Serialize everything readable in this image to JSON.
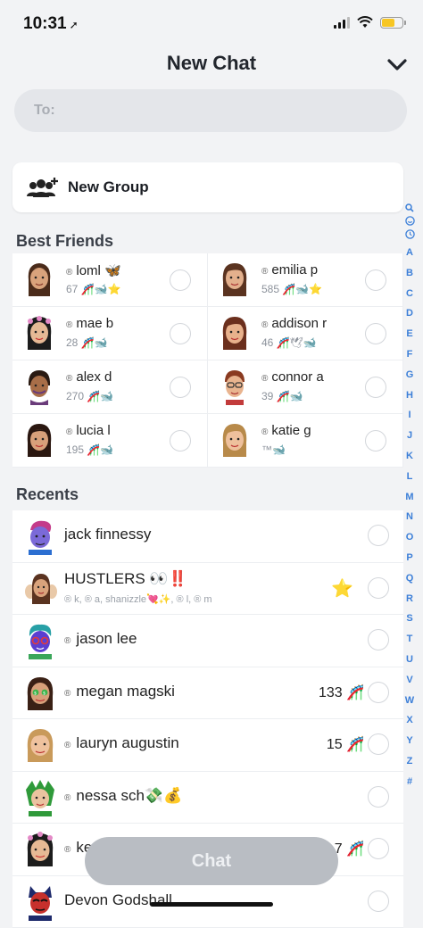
{
  "status": {
    "time": "10:31",
    "location_icon": "location-arrow-icon"
  },
  "header": {
    "title": "New Chat",
    "collapse_icon": "chevron-down-icon"
  },
  "to_field": {
    "label": "To:",
    "placeholder": ""
  },
  "new_group": {
    "label": "New Group",
    "icon": "add-group-icon"
  },
  "best_friends": {
    "heading": "Best Friends",
    "items": [
      {
        "name": "loml 🦋",
        "sub": "67 🎢🐋⭐"
      },
      {
        "name": "emilia p",
        "sub": "585 🎢🐋⭐"
      },
      {
        "name": "mae b",
        "sub": "28 🎢🐋"
      },
      {
        "name": "addison r",
        "sub": "46 🎢🕊🐋"
      },
      {
        "name": "alex d",
        "sub": "270 🎢🐋"
      },
      {
        "name": "connor a",
        "sub": "39 🎢🐋"
      },
      {
        "name": "lucia l",
        "sub": "195 🎢🐋"
      },
      {
        "name": "katie g",
        "sub": "™🐋"
      }
    ]
  },
  "recents": {
    "heading": "Recents",
    "items": [
      {
        "name": "jack finnessy",
        "reg": false,
        "score": ""
      },
      {
        "name": "HUSTLERS 👀‼️",
        "reg": false,
        "score": "",
        "members": "® k, ® a, shanizzle💘✨, ® l, ® m",
        "star": "⭐"
      },
      {
        "name": "jason lee",
        "reg": true,
        "score": ""
      },
      {
        "name": "megan magski",
        "reg": true,
        "score": "133 🎢"
      },
      {
        "name": "lauryn augustin",
        "reg": true,
        "score": "15 🎢"
      },
      {
        "name": "nessa sch💸💰",
        "reg": true,
        "score": ""
      },
      {
        "name": "ke",
        "reg": true,
        "score": "7 🎢"
      },
      {
        "name": "Devon Godshall",
        "reg": false,
        "score": ""
      }
    ]
  },
  "az_index": [
    "A",
    "B",
    "C",
    "D",
    "E",
    "F",
    "G",
    "H",
    "I",
    "J",
    "K",
    "L",
    "M",
    "N",
    "O",
    "P",
    "Q",
    "R",
    "S",
    "T",
    "U",
    "V",
    "W",
    "X",
    "Y",
    "Z",
    "#"
  ],
  "chat_button": {
    "label": "Chat"
  },
  "reg_mark": "®"
}
